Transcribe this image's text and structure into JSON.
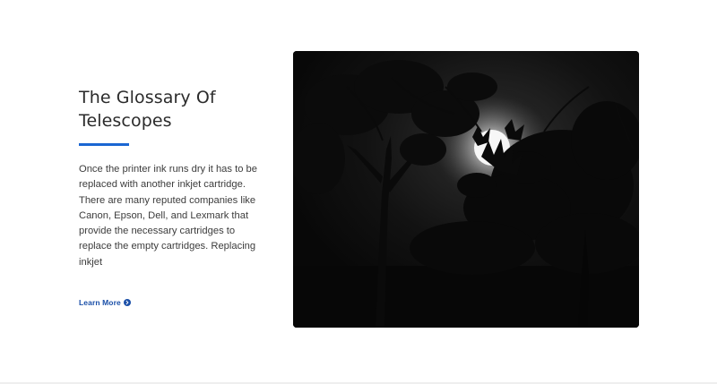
{
  "feature": {
    "title_line1": "The Glossary Of",
    "title_line2": "Telescopes",
    "body": "Once the printer ink runs dry it has to be replaced with another inkjet cartridge. There are many reputed companies like Canon, Epson, Dell, and Lexmark that provide the necessary cartridges to replace the empty cartridges. Replacing inkjet",
    "link_label": "Learn More",
    "link_icon": "arrow-circle-right-icon",
    "accent_color": "#1a66d2",
    "link_color": "#1a4fa8"
  },
  "image": {
    "subject": "moon-behind-tree-silhouettes-photo"
  }
}
